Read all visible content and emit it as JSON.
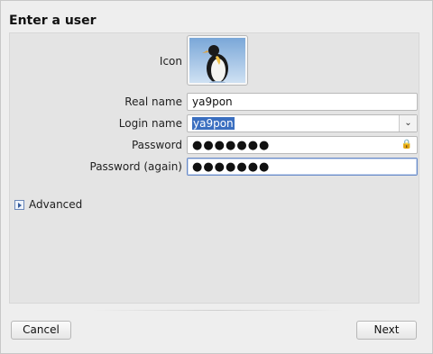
{
  "header": {
    "title": "Enter a user"
  },
  "form": {
    "icon_label": "Icon",
    "real_name": {
      "label": "Real name",
      "value": "ya9pon"
    },
    "login_name": {
      "label": "Login name",
      "value": "ya9pon"
    },
    "password": {
      "label": "Password",
      "value": "●●●●●●●"
    },
    "password_again": {
      "label": "Password (again)",
      "value": "●●●●●●●"
    },
    "advanced_label": "Advanced"
  },
  "footer": {
    "cancel_label": "Cancel",
    "next_label": "Next"
  },
  "colors": {
    "selection": "#3b6fc0",
    "focus_border": "#6a8bc8"
  },
  "icons": [
    "penguin-avatar-icon",
    "chevron-down-icon",
    "lock-icon",
    "expander-arrow-icon"
  ]
}
